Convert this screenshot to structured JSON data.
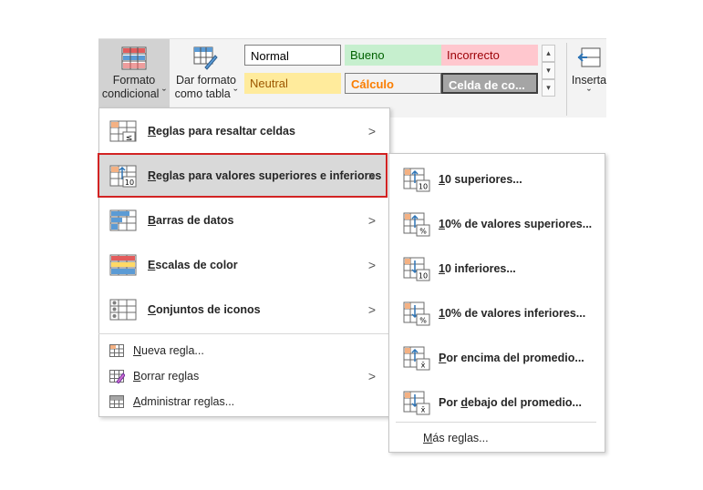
{
  "ribbon": {
    "formato_condicional": {
      "line1": "Formato",
      "line2": "condicional ˇ"
    },
    "dar_formato": {
      "line1": "Dar formato",
      "line2": "como tabla ˇ"
    },
    "insertar": {
      "line1": "Inserta",
      "line2": "ˇ"
    },
    "styles": [
      {
        "label": "Normal",
        "bg": "#ffffff",
        "color": "#000000"
      },
      {
        "label": "Bueno",
        "bg": "#c6efce",
        "color": "#006100"
      },
      {
        "label": "Incorrecto",
        "bg": "#ffc7ce",
        "color": "#9c0006"
      },
      {
        "label": "Neutral",
        "bg": "#ffeb9c",
        "color": "#9c5700"
      },
      {
        "label": "Cálculo",
        "bg": "#f2f2f2",
        "color": "#fa7d00"
      },
      {
        "label": "Celda de co...",
        "bg": "#a5a5a5",
        "color": "#ffffff"
      }
    ]
  },
  "menu": {
    "items": [
      {
        "label": "Reglas para resaltar celdas",
        "underline": "R",
        "rest": "eglas para resaltar celdas",
        "icon": "highlight-rules-icon"
      },
      {
        "label": "Reglas para valores superiores e inferiores",
        "underline": "R",
        "rest": "eglas para valores superiores e inferiores",
        "icon": "top-bottom-rules-icon"
      },
      {
        "label": "Barras de datos",
        "underline": "B",
        "rest": "arras de datos",
        "icon": "data-bars-icon"
      },
      {
        "label": "Escalas de color",
        "underline": "E",
        "rest": "scalas de color",
        "icon": "color-scales-icon"
      },
      {
        "label": "Conjuntos de iconos",
        "underline": "C",
        "rest": "onjuntos de iconos",
        "icon": "icon-sets-icon"
      }
    ],
    "small_items": [
      {
        "underline": "N",
        "rest": "ueva regla...",
        "icon": "new-rule-icon"
      },
      {
        "underline": "B",
        "rest": "orrar reglas",
        "icon": "clear-rules-icon"
      },
      {
        "underline": "A",
        "rest": "dministrar reglas...",
        "icon": "manage-rules-icon"
      }
    ]
  },
  "submenu": {
    "items": [
      {
        "underline": "1",
        "rest": "0 superiores...",
        "badge": "10"
      },
      {
        "underline": "1",
        "rest": "0% de valores superiores...",
        "badge": "%"
      },
      {
        "underline": "1",
        "rest": "0 inferiores...",
        "badge": "10"
      },
      {
        "underline": "1",
        "rest": "0% de valores inferiores...",
        "badge": "%"
      },
      {
        "underline": "P",
        "rest": "or encima del promedio...",
        "badge": "x̄"
      },
      {
        "pre": "Por ",
        "underline": "d",
        "rest": "ebajo del promedio...",
        "badge": "x̄"
      }
    ],
    "more": {
      "underline": "M",
      "rest": "ás reglas..."
    }
  },
  "arrow_glyph": ">"
}
